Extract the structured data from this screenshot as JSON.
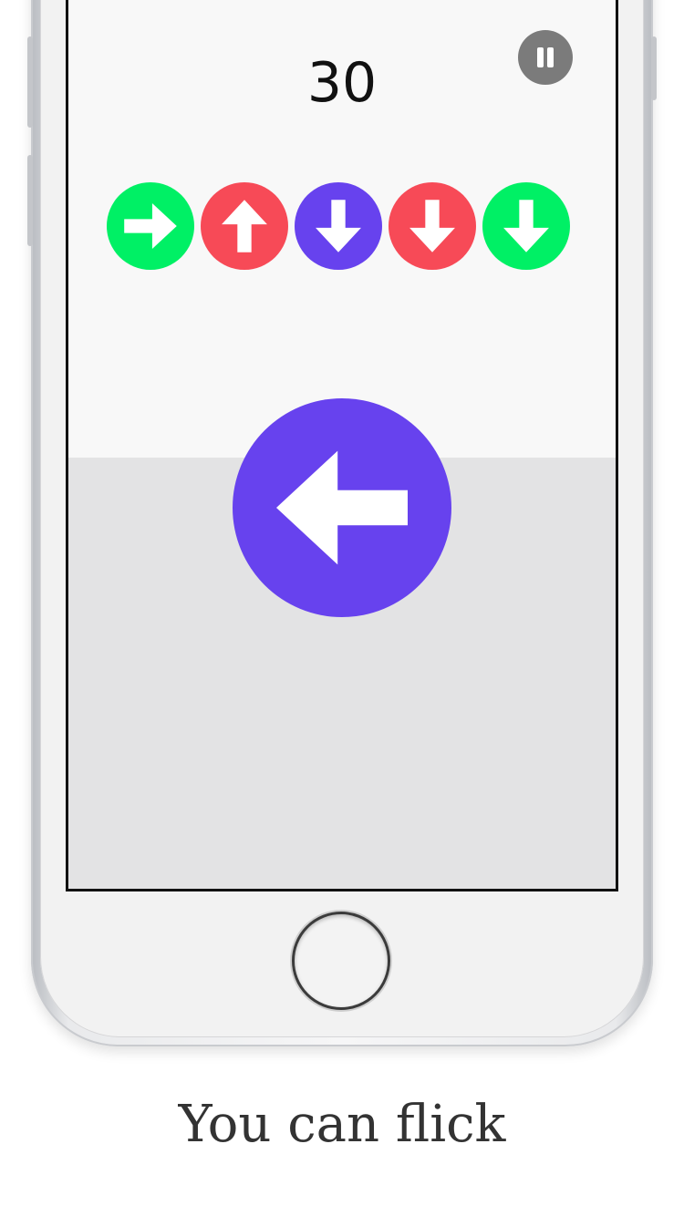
{
  "game": {
    "score": "30",
    "queue": [
      {
        "direction": "right",
        "color": "#00f065"
      },
      {
        "direction": "up",
        "color": "#f74a57"
      },
      {
        "direction": "down",
        "color": "#6742ee"
      },
      {
        "direction": "down",
        "color": "#f74a57"
      },
      {
        "direction": "down",
        "color": "#00f065"
      }
    ],
    "current": {
      "direction": "left",
      "color": "#6742ee"
    },
    "pause_icon": "pause-icon"
  },
  "caption": "You can flick"
}
